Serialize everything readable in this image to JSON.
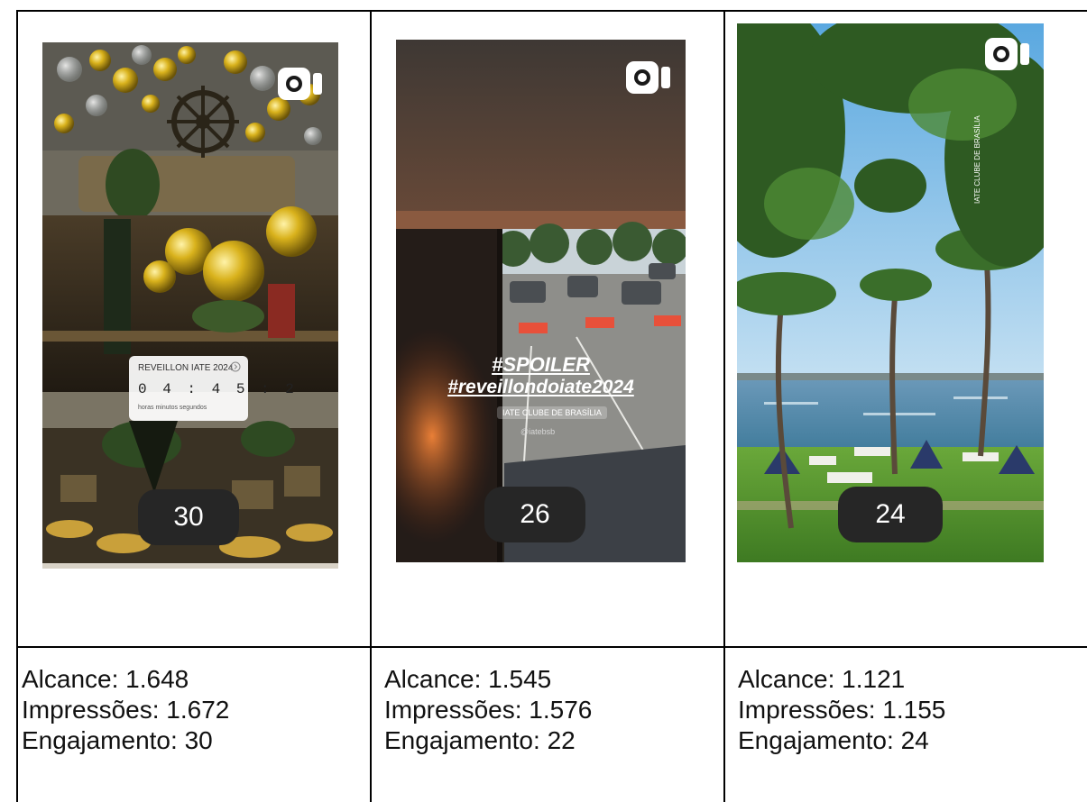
{
  "posts": [
    {
      "views_badge": "30",
      "stats": [
        "Alcance: 1.648",
        "Impressões: 1.672",
        "Engajamento: 30"
      ],
      "timer": {
        "title": "REVEILLON IATE 2024",
        "digits": "0 4 : 4 5 : 2",
        "units": "horas        minutos        segundos"
      }
    },
    {
      "views_badge": "26",
      "stats": [
        "Alcance: 1.545",
        "Impressões: 1.576",
        "Engajamento: 22"
      ],
      "overlay": {
        "line1": "#SPOILER",
        "line2": "#reveillondoiate2024",
        "location": "IATE CLUBE DE BRASÍLIA",
        "handle": "@iatebsb"
      }
    },
    {
      "views_badge": "24",
      "stats": [
        "Alcance: 1.121",
        "Impressões: 1.155",
        "Engajamento: 24"
      ],
      "side_label": "IATE CLUBE DE BRASÍLIA"
    }
  ],
  "icons": {
    "reel": "reels-icon"
  },
  "colors": {
    "badge": "#262626",
    "border": "#000000"
  }
}
